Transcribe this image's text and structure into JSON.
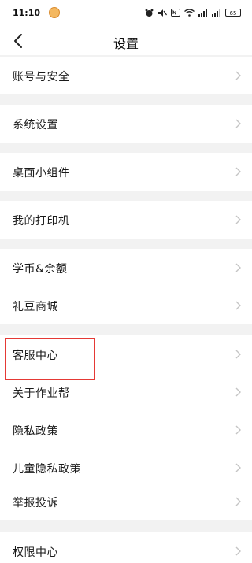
{
  "status_bar": {
    "time": "11:10",
    "battery": "65",
    "icons": [
      "app-notification-icon",
      "alarm-icon",
      "mute-icon",
      "nfc-icon",
      "wifi-icon",
      "signal-icon",
      "signal-icon",
      "battery-icon"
    ]
  },
  "nav": {
    "title": "设置",
    "back_icon": "chevron-left-icon"
  },
  "settings": {
    "items": [
      {
        "label": "账号与安全"
      },
      {
        "label": "系统设置"
      },
      {
        "label": "桌面小组件"
      },
      {
        "label": "我的打印机"
      },
      {
        "label": "学币&余额"
      },
      {
        "label": "礼豆商城"
      },
      {
        "label": "客服中心"
      },
      {
        "label": "关于作业帮"
      },
      {
        "label": "隐私政策"
      },
      {
        "label": "儿童隐私政策"
      },
      {
        "label": "举报投诉"
      },
      {
        "label": "权限中心"
      }
    ]
  },
  "colors": {
    "background": "#f2f2f2",
    "row": "#ffffff",
    "highlight": "#e53935",
    "chevron": "#c4c4c4"
  },
  "highlight": {
    "target": "客服中心"
  }
}
